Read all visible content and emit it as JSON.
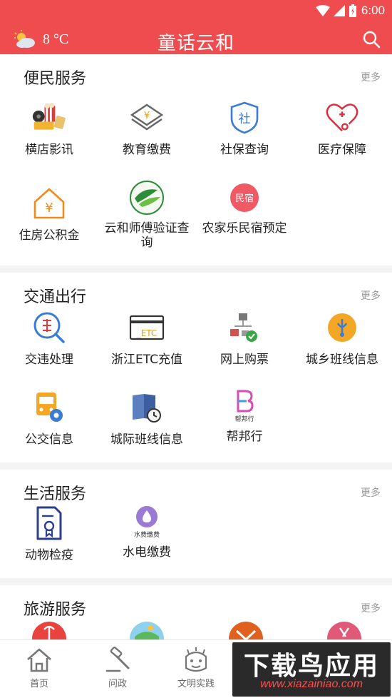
{
  "status": {
    "time": "6:00"
  },
  "header": {
    "weather_temp": "8 °C",
    "title": "童话云和"
  },
  "sections": [
    {
      "title": "便民服务",
      "more": "更多",
      "items": [
        "横店影讯",
        "教育缴费",
        "社保查询",
        "医疗保障",
        "住房公积金",
        "云和师傅验证查询",
        "农家乐民宿预定"
      ]
    },
    {
      "title": "交通出行",
      "more": "更多",
      "items": [
        "交违处理",
        "浙江ETC充值",
        "网上购票",
        "城乡班线信息",
        "公交信息",
        "城际班线信息",
        "帮邦行"
      ]
    },
    {
      "title": "生活服务",
      "more": "更多",
      "items": [
        "动物检疫",
        "水电缴费"
      ]
    },
    {
      "title": "旅游服务",
      "more": "更多",
      "items": []
    }
  ],
  "icon_text": {
    "shebao": "社",
    "etc": "_ETC",
    "minsu": "民宿",
    "bangbang": "帮邦行",
    "shuidian": "水费缴费",
    "yuan": "¥"
  },
  "nav": [
    {
      "label": "首页"
    },
    {
      "label": "问政"
    },
    {
      "label": "文明实践"
    }
  ],
  "watermark": {
    "text": "下载鸟应用",
    "url": "www.xiazainiao.com"
  },
  "colors": {
    "header": "#ef4c4f",
    "accent_blue": "#3a7bd5",
    "accent_orange": "#f08a1c"
  }
}
